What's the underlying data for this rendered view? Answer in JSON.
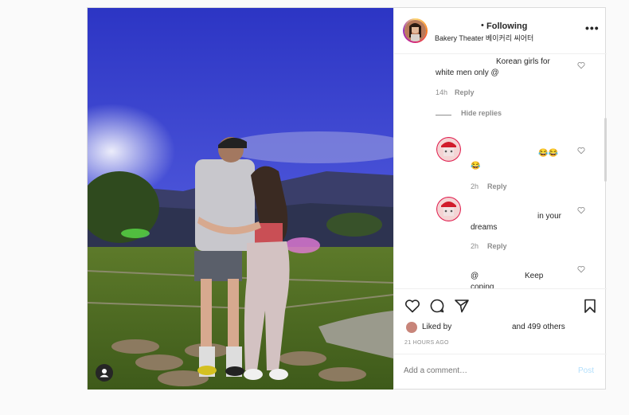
{
  "header": {
    "dot": "•",
    "following": "Following",
    "location": "Bakery Theater 베이커리 씨어터",
    "more": "•••"
  },
  "comments": [
    {
      "text": "Korean girls for",
      "text2": "white men only @",
      "time": "14h",
      "reply": "Reply"
    },
    {
      "hide_replies": "Hide replies"
    },
    {
      "emoji": "😂😂",
      "emoji2": "😂",
      "time": "2h",
      "reply": "Reply"
    },
    {
      "text": "in your",
      "text2": "dreams",
      "time": "2h",
      "reply": "Reply"
    },
    {
      "text_a": "@",
      "text_b": "Keep",
      "text2": "coping"
    }
  ],
  "likes": {
    "prefix": "Liked by",
    "suffix": "and 499 others"
  },
  "time": "21 HOURS AGO",
  "add_comment": {
    "placeholder": "Add a comment…",
    "post": "Post"
  },
  "colors": {
    "post_disabled": "#b2dffc",
    "border": "#dbdbdb",
    "meta": "#8e8e8e"
  }
}
